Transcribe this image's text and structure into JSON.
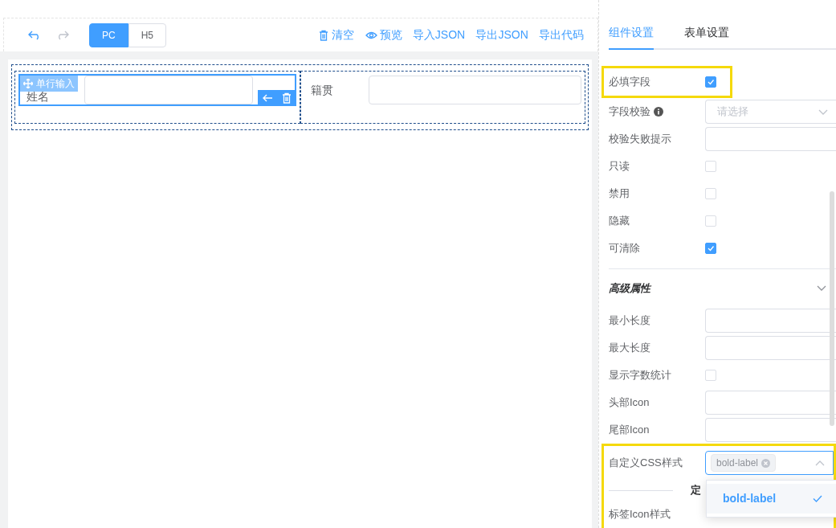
{
  "toolbar": {
    "undo": {
      "disabled": false
    },
    "redo": {
      "disabled": true
    },
    "devices": [
      {
        "label": "PC",
        "selected": true
      },
      {
        "label": "H5",
        "selected": false
      }
    ],
    "actions": [
      {
        "label": "清空"
      },
      {
        "label": "预览"
      },
      {
        "label": "导入JSON"
      },
      {
        "label": "导出JSON"
      },
      {
        "label": "导出代码"
      }
    ]
  },
  "canvas": {
    "fields": [
      {
        "label": "姓名",
        "selected": true,
        "widget_tag": "单行输入"
      },
      {
        "label": "籍贯",
        "selected": false
      }
    ]
  },
  "panel": {
    "tabs": [
      {
        "label": "组件设置",
        "selected": true
      },
      {
        "label": "表单设置",
        "selected": false
      }
    ],
    "settings": [
      {
        "kind": "checkbox",
        "label": "必填字段",
        "checked": true,
        "highlighted": true
      },
      {
        "kind": "select",
        "label": "字段校验",
        "info": true,
        "placeholder": "请选择"
      },
      {
        "kind": "input",
        "label": "校验失败提示"
      },
      {
        "kind": "checkbox",
        "label": "只读",
        "checked": false
      },
      {
        "kind": "checkbox",
        "label": "禁用",
        "checked": false
      },
      {
        "kind": "checkbox",
        "label": "隐藏",
        "checked": false
      },
      {
        "kind": "checkbox",
        "label": "可清除",
        "checked": true
      }
    ],
    "section": {
      "title": "高级属性",
      "expanded": true
    },
    "advanced": [
      {
        "kind": "input",
        "label": "最小长度"
      },
      {
        "kind": "input",
        "label": "最大长度"
      },
      {
        "kind": "checkbox",
        "label": "显示字数统计",
        "checked": false
      },
      {
        "kind": "input",
        "label": "头部Icon"
      },
      {
        "kind": "input",
        "label": "尾部Icon"
      }
    ],
    "custom_css": {
      "highlighted": true,
      "label": "自定义CSS样式",
      "tags": [
        "bold-label"
      ],
      "open": true,
      "options": [
        {
          "label": "bold-label",
          "selected": true
        }
      ],
      "divider_text": "定",
      "next_label": "标签Icon样式"
    }
  }
}
